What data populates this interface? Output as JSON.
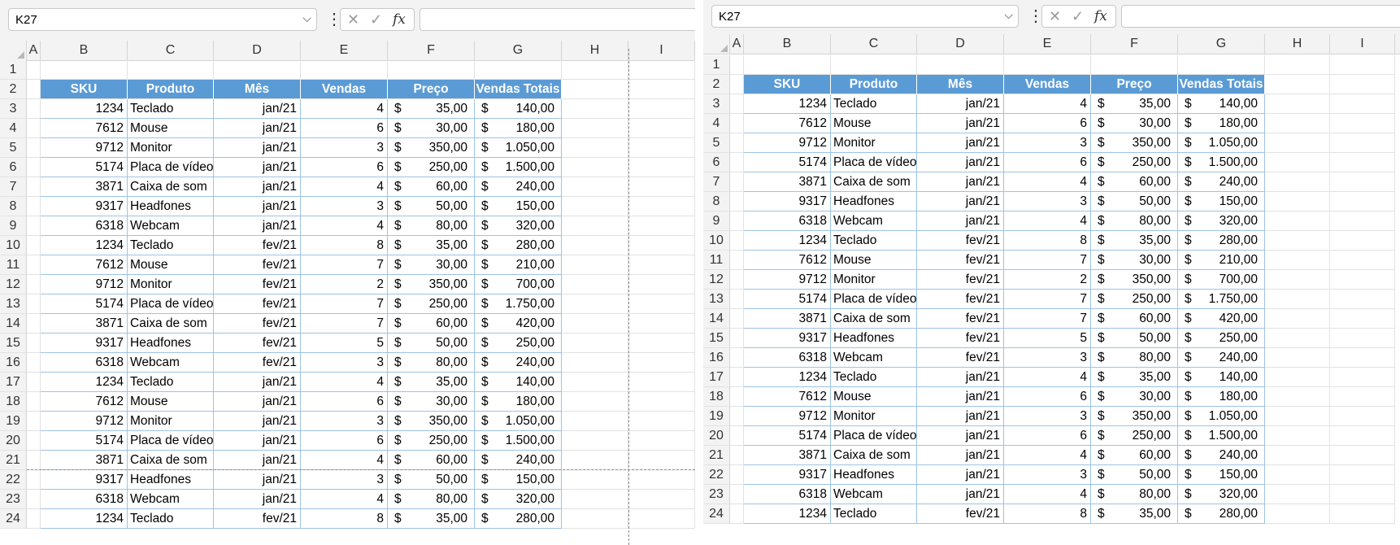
{
  "name_box": "K27",
  "namebox_chevron_icon": "chevron-down-icon",
  "formula_icons": [
    "cancel-x-icon",
    "enter-check-icon",
    "fx-icon"
  ],
  "fx_label": "fx",
  "columns": [
    "A",
    "B",
    "C",
    "D",
    "E",
    "F",
    "G",
    "H",
    "I"
  ],
  "table_header": [
    "SKU",
    "Produto",
    "Mês",
    "Vendas",
    "Preço",
    "Vendas Totais"
  ],
  "currency_symbol": "$",
  "header_color": "#5B9BD5",
  "rows": [
    {
      "n": "3",
      "sku": "1234",
      "produto": "Teclado",
      "mes": "jan/21",
      "vendas": "4",
      "preco": "35,00",
      "total": "140,00"
    },
    {
      "n": "4",
      "sku": "7612",
      "produto": "Mouse",
      "mes": "jan/21",
      "vendas": "6",
      "preco": "30,00",
      "total": "180,00"
    },
    {
      "n": "5",
      "sku": "9712",
      "produto": "Monitor",
      "mes": "jan/21",
      "vendas": "3",
      "preco": "350,00",
      "total": "1.050,00"
    },
    {
      "n": "6",
      "sku": "5174",
      "produto": "Placa de vídeo",
      "mes": "jan/21",
      "vendas": "6",
      "preco": "250,00",
      "total": "1.500,00"
    },
    {
      "n": "7",
      "sku": "3871",
      "produto": "Caixa de som",
      "mes": "jan/21",
      "vendas": "4",
      "preco": "60,00",
      "total": "240,00"
    },
    {
      "n": "8",
      "sku": "9317",
      "produto": "Headfones",
      "mes": "jan/21",
      "vendas": "3",
      "preco": "50,00",
      "total": "150,00"
    },
    {
      "n": "9",
      "sku": "6318",
      "produto": "Webcam",
      "mes": "jan/21",
      "vendas": "4",
      "preco": "80,00",
      "total": "320,00"
    },
    {
      "n": "10",
      "sku": "1234",
      "produto": "Teclado",
      "mes": "fev/21",
      "vendas": "8",
      "preco": "35,00",
      "total": "280,00"
    },
    {
      "n": "11",
      "sku": "7612",
      "produto": "Mouse",
      "mes": "fev/21",
      "vendas": "7",
      "preco": "30,00",
      "total": "210,00"
    },
    {
      "n": "12",
      "sku": "9712",
      "produto": "Monitor",
      "mes": "fev/21",
      "vendas": "2",
      "preco": "350,00",
      "total": "700,00"
    },
    {
      "n": "13",
      "sku": "5174",
      "produto": "Placa de vídeo",
      "mes": "fev/21",
      "vendas": "7",
      "preco": "250,00",
      "total": "1.750,00"
    },
    {
      "n": "14",
      "sku": "3871",
      "produto": "Caixa de som",
      "mes": "fev/21",
      "vendas": "7",
      "preco": "60,00",
      "total": "420,00"
    },
    {
      "n": "15",
      "sku": "9317",
      "produto": "Headfones",
      "mes": "fev/21",
      "vendas": "5",
      "preco": "50,00",
      "total": "250,00"
    },
    {
      "n": "16",
      "sku": "6318",
      "produto": "Webcam",
      "mes": "fev/21",
      "vendas": "3",
      "preco": "80,00",
      "total": "240,00"
    },
    {
      "n": "17",
      "sku": "1234",
      "produto": "Teclado",
      "mes": "jan/21",
      "vendas": "4",
      "preco": "35,00",
      "total": "140,00"
    },
    {
      "n": "18",
      "sku": "7612",
      "produto": "Mouse",
      "mes": "jan/21",
      "vendas": "6",
      "preco": "30,00",
      "total": "180,00"
    },
    {
      "n": "19",
      "sku": "9712",
      "produto": "Monitor",
      "mes": "jan/21",
      "vendas": "3",
      "preco": "350,00",
      "total": "1.050,00"
    },
    {
      "n": "20",
      "sku": "5174",
      "produto": "Placa de vídeo",
      "mes": "jan/21",
      "vendas": "6",
      "preco": "250,00",
      "total": "1.500,00"
    },
    {
      "n": "21",
      "sku": "3871",
      "produto": "Caixa de som",
      "mes": "jan/21",
      "vendas": "4",
      "preco": "60,00",
      "total": "240,00"
    },
    {
      "n": "22",
      "sku": "9317",
      "produto": "Headfones",
      "mes": "jan/21",
      "vendas": "3",
      "preco": "50,00",
      "total": "150,00"
    },
    {
      "n": "23",
      "sku": "6318",
      "produto": "Webcam",
      "mes": "jan/21",
      "vendas": "4",
      "preco": "80,00",
      "total": "320,00"
    },
    {
      "n": "24",
      "sku": "1234",
      "produto": "Teclado",
      "mes": "fev/21",
      "vendas": "8",
      "preco": "35,00",
      "total": "280,00"
    }
  ]
}
